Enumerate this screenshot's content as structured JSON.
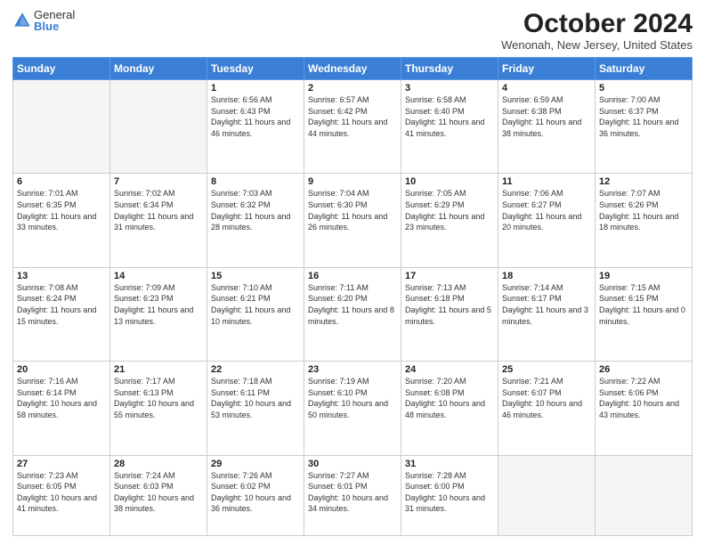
{
  "header": {
    "logo_general": "General",
    "logo_blue": "Blue",
    "month_title": "October 2024",
    "location": "Wenonah, New Jersey, United States"
  },
  "days_of_week": [
    "Sunday",
    "Monday",
    "Tuesday",
    "Wednesday",
    "Thursday",
    "Friday",
    "Saturday"
  ],
  "weeks": [
    [
      {
        "day": "",
        "info": ""
      },
      {
        "day": "",
        "info": ""
      },
      {
        "day": "1",
        "info": "Sunrise: 6:56 AM\nSunset: 6:43 PM\nDaylight: 11 hours and 46 minutes."
      },
      {
        "day": "2",
        "info": "Sunrise: 6:57 AM\nSunset: 6:42 PM\nDaylight: 11 hours and 44 minutes."
      },
      {
        "day": "3",
        "info": "Sunrise: 6:58 AM\nSunset: 6:40 PM\nDaylight: 11 hours and 41 minutes."
      },
      {
        "day": "4",
        "info": "Sunrise: 6:59 AM\nSunset: 6:38 PM\nDaylight: 11 hours and 38 minutes."
      },
      {
        "day": "5",
        "info": "Sunrise: 7:00 AM\nSunset: 6:37 PM\nDaylight: 11 hours and 36 minutes."
      }
    ],
    [
      {
        "day": "6",
        "info": "Sunrise: 7:01 AM\nSunset: 6:35 PM\nDaylight: 11 hours and 33 minutes."
      },
      {
        "day": "7",
        "info": "Sunrise: 7:02 AM\nSunset: 6:34 PM\nDaylight: 11 hours and 31 minutes."
      },
      {
        "day": "8",
        "info": "Sunrise: 7:03 AM\nSunset: 6:32 PM\nDaylight: 11 hours and 28 minutes."
      },
      {
        "day": "9",
        "info": "Sunrise: 7:04 AM\nSunset: 6:30 PM\nDaylight: 11 hours and 26 minutes."
      },
      {
        "day": "10",
        "info": "Sunrise: 7:05 AM\nSunset: 6:29 PM\nDaylight: 11 hours and 23 minutes."
      },
      {
        "day": "11",
        "info": "Sunrise: 7:06 AM\nSunset: 6:27 PM\nDaylight: 11 hours and 20 minutes."
      },
      {
        "day": "12",
        "info": "Sunrise: 7:07 AM\nSunset: 6:26 PM\nDaylight: 11 hours and 18 minutes."
      }
    ],
    [
      {
        "day": "13",
        "info": "Sunrise: 7:08 AM\nSunset: 6:24 PM\nDaylight: 11 hours and 15 minutes."
      },
      {
        "day": "14",
        "info": "Sunrise: 7:09 AM\nSunset: 6:23 PM\nDaylight: 11 hours and 13 minutes."
      },
      {
        "day": "15",
        "info": "Sunrise: 7:10 AM\nSunset: 6:21 PM\nDaylight: 11 hours and 10 minutes."
      },
      {
        "day": "16",
        "info": "Sunrise: 7:11 AM\nSunset: 6:20 PM\nDaylight: 11 hours and 8 minutes."
      },
      {
        "day": "17",
        "info": "Sunrise: 7:13 AM\nSunset: 6:18 PM\nDaylight: 11 hours and 5 minutes."
      },
      {
        "day": "18",
        "info": "Sunrise: 7:14 AM\nSunset: 6:17 PM\nDaylight: 11 hours and 3 minutes."
      },
      {
        "day": "19",
        "info": "Sunrise: 7:15 AM\nSunset: 6:15 PM\nDaylight: 11 hours and 0 minutes."
      }
    ],
    [
      {
        "day": "20",
        "info": "Sunrise: 7:16 AM\nSunset: 6:14 PM\nDaylight: 10 hours and 58 minutes."
      },
      {
        "day": "21",
        "info": "Sunrise: 7:17 AM\nSunset: 6:13 PM\nDaylight: 10 hours and 55 minutes."
      },
      {
        "day": "22",
        "info": "Sunrise: 7:18 AM\nSunset: 6:11 PM\nDaylight: 10 hours and 53 minutes."
      },
      {
        "day": "23",
        "info": "Sunrise: 7:19 AM\nSunset: 6:10 PM\nDaylight: 10 hours and 50 minutes."
      },
      {
        "day": "24",
        "info": "Sunrise: 7:20 AM\nSunset: 6:08 PM\nDaylight: 10 hours and 48 minutes."
      },
      {
        "day": "25",
        "info": "Sunrise: 7:21 AM\nSunset: 6:07 PM\nDaylight: 10 hours and 46 minutes."
      },
      {
        "day": "26",
        "info": "Sunrise: 7:22 AM\nSunset: 6:06 PM\nDaylight: 10 hours and 43 minutes."
      }
    ],
    [
      {
        "day": "27",
        "info": "Sunrise: 7:23 AM\nSunset: 6:05 PM\nDaylight: 10 hours and 41 minutes."
      },
      {
        "day": "28",
        "info": "Sunrise: 7:24 AM\nSunset: 6:03 PM\nDaylight: 10 hours and 38 minutes."
      },
      {
        "day": "29",
        "info": "Sunrise: 7:26 AM\nSunset: 6:02 PM\nDaylight: 10 hours and 36 minutes."
      },
      {
        "day": "30",
        "info": "Sunrise: 7:27 AM\nSunset: 6:01 PM\nDaylight: 10 hours and 34 minutes."
      },
      {
        "day": "31",
        "info": "Sunrise: 7:28 AM\nSunset: 6:00 PM\nDaylight: 10 hours and 31 minutes."
      },
      {
        "day": "",
        "info": ""
      },
      {
        "day": "",
        "info": ""
      }
    ]
  ]
}
